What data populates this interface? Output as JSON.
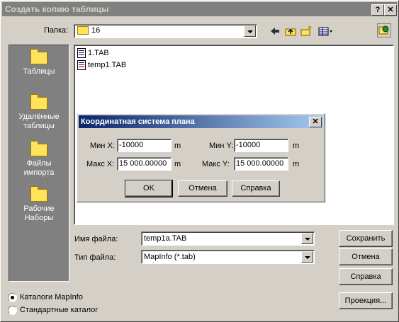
{
  "window": {
    "title": "Создать копию таблицы",
    "help_glyph": "?",
    "close_glyph": "✕"
  },
  "lookin": {
    "label": "Папка:",
    "value": "16"
  },
  "places": [
    {
      "label_l1": "Таблицы",
      "label_l2": ""
    },
    {
      "label_l1": "Удалённые",
      "label_l2": "таблицы"
    },
    {
      "label_l1": "Файлы",
      "label_l2": "импорта"
    },
    {
      "label_l1": "Рабочие",
      "label_l2": "Наборы"
    }
  ],
  "files": [
    "1.TAB",
    "temp1.TAB"
  ],
  "dialog": {
    "title": "Координатная система плана",
    "close_glyph": "✕",
    "min_x_label": "Мин X:",
    "min_x_value": "-10000",
    "min_y_label": "Мин Y:",
    "min_y_value": "-10000",
    "max_x_label": "Макс X:",
    "max_x_value": "15 000.00000",
    "max_y_label": "Макс Y:",
    "max_y_value": "15 000.00000",
    "unit": "m",
    "ok": "OK",
    "cancel": "Отмена",
    "help": "Справка"
  },
  "filename": {
    "label": "Имя файла:",
    "value": "temp1a.TAB"
  },
  "filetype": {
    "label": "Тип файла:",
    "value": "MapInfo (*.tab)"
  },
  "buttons": {
    "save": "Сохранить",
    "cancel": "Отмена",
    "help": "Справка",
    "projection": "Проекция..."
  },
  "radios": {
    "mapinfo": "Каталоги MapInfo",
    "standard": "Стандартные каталог",
    "selected": "mapinfo"
  },
  "colors": {
    "dialog_face": "#d4d0c8",
    "inactive_title": "#808080",
    "active_title": "#0a246a",
    "places_bg": "#808080"
  }
}
